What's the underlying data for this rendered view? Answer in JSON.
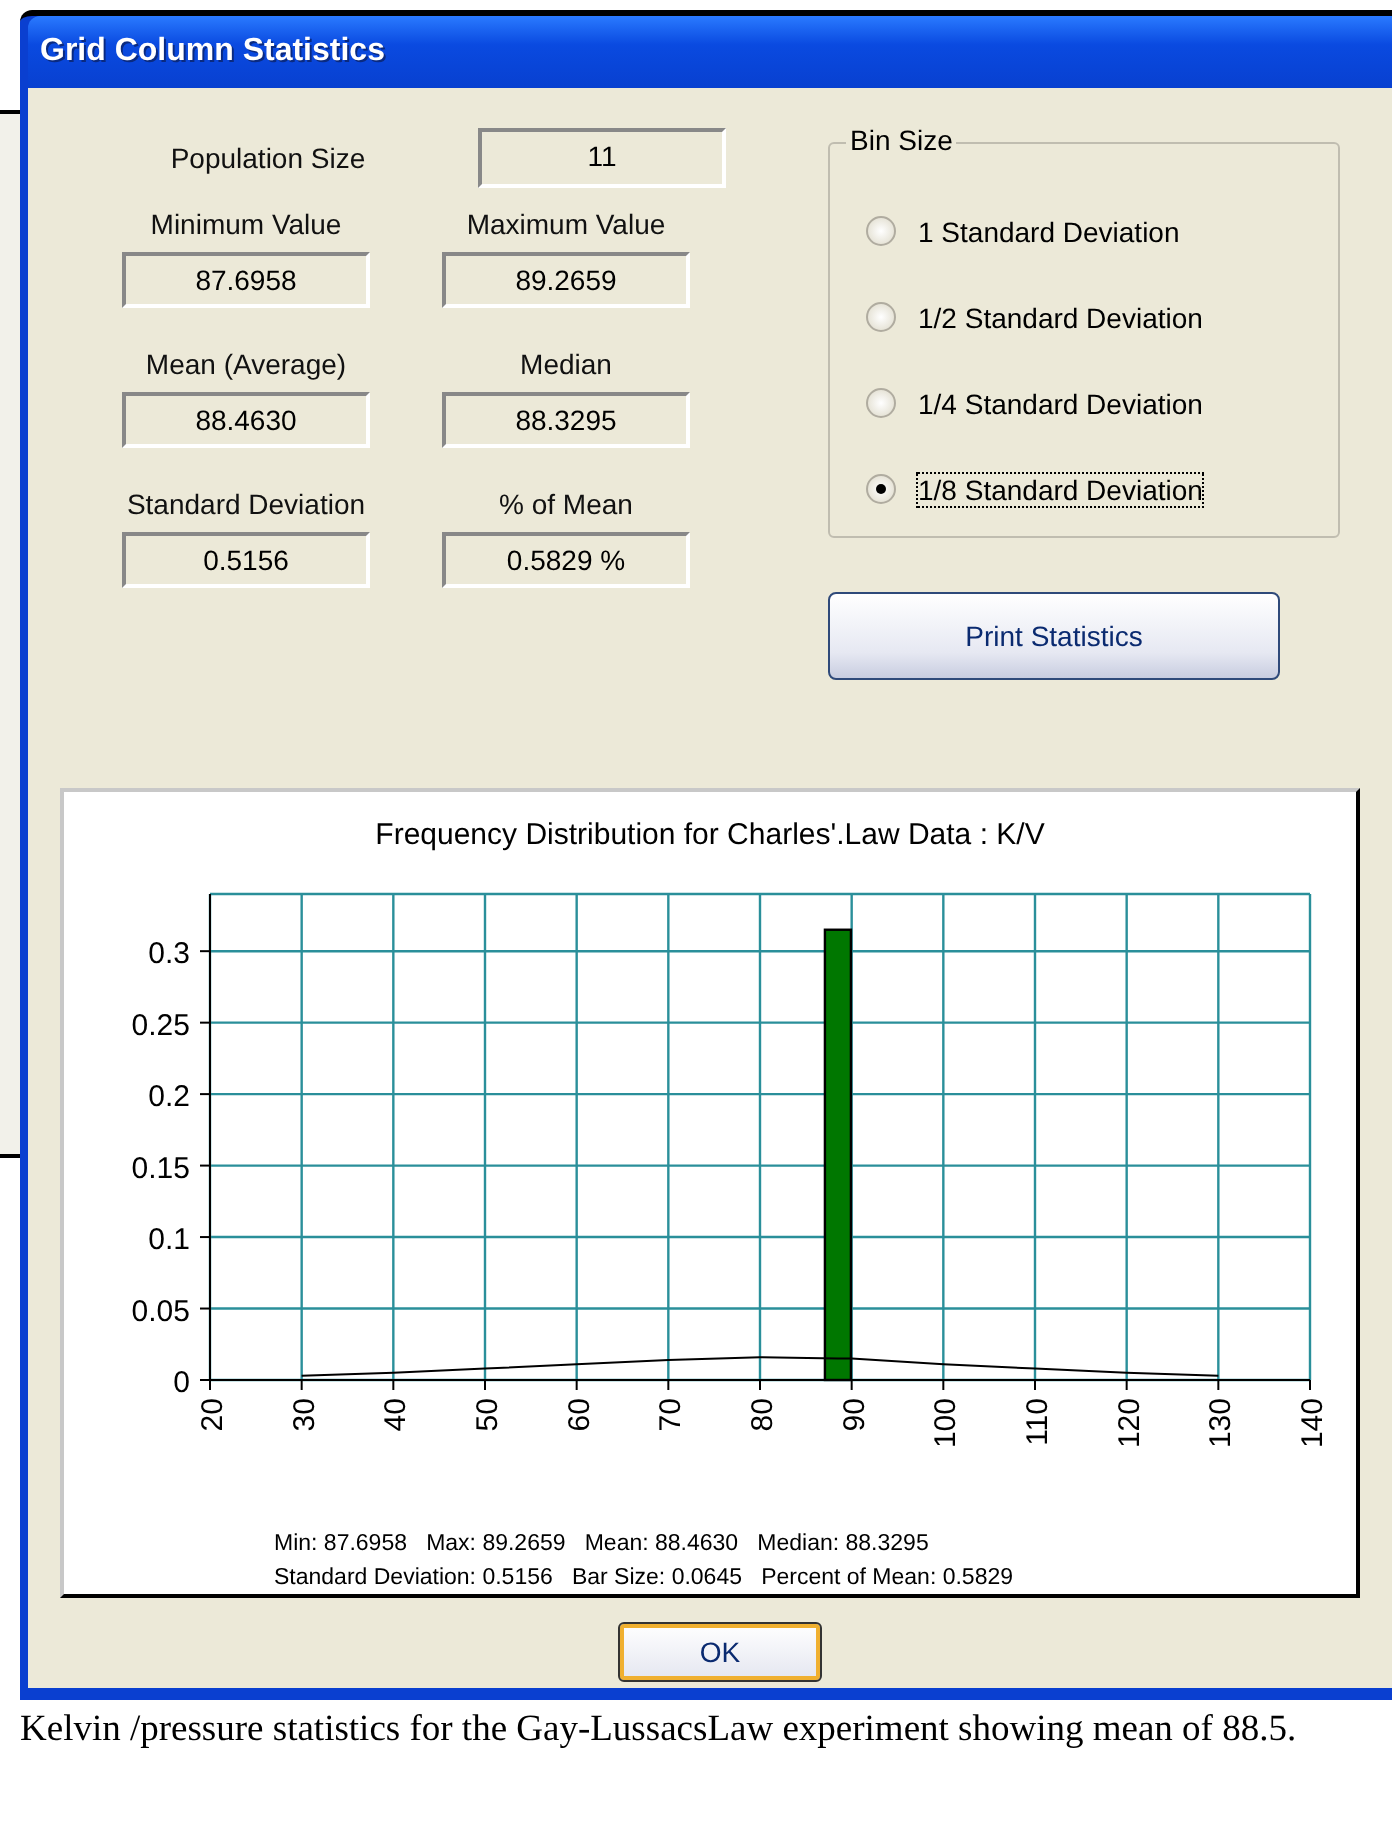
{
  "window": {
    "title": "Grid Column Statistics"
  },
  "fields": [
    {
      "label": "Population Size",
      "value": "11"
    },
    {
      "label": "Minimum Value",
      "value": "87.6958"
    },
    {
      "label": "Maximum Value",
      "value": "89.2659"
    },
    {
      "label": "Mean (Average)",
      "value": "88.4630"
    },
    {
      "label": "Median",
      "value": "88.3295"
    },
    {
      "label": "Standard Deviation",
      "value": "0.5156"
    },
    {
      "label": "% of Mean",
      "value": "0.5829 %"
    }
  ],
  "bin_size": {
    "title": "Bin Size",
    "options": [
      {
        "label": "1 Standard Deviation",
        "selected": false
      },
      {
        "label": "1/2 Standard Deviation",
        "selected": false
      },
      {
        "label": "1/4 Standard Deviation",
        "selected": false
      },
      {
        "label": "1/8 Standard Deviation",
        "selected": true
      }
    ]
  },
  "print_button": "Print Statistics",
  "chart": {
    "chart_data": {
      "type": "bar",
      "title": "Frequency Distribution for Charles'.Law Data : K/V",
      "x": [
        30,
        40,
        50,
        60,
        70,
        80,
        88.5,
        90,
        100,
        110,
        120,
        130
      ],
      "series": [
        {
          "type": "bar",
          "color": "#007700",
          "values": [
            null,
            null,
            null,
            null,
            null,
            null,
            0.315,
            null,
            null,
            null,
            null,
            null
          ]
        },
        {
          "type": "line",
          "color": "#000000",
          "values": [
            0.003,
            0.005,
            0.008,
            0.011,
            0.014,
            0.016,
            0.015,
            0.015,
            0.011,
            0.008,
            0.005,
            0.003
          ]
        }
      ],
      "grid": true,
      "xlim": [
        20,
        140
      ],
      "ylim": [
        0,
        0.34
      ],
      "xticks": [
        20,
        30,
        40,
        50,
        60,
        70,
        80,
        90,
        100,
        110,
        120,
        130,
        140
      ],
      "yticks": [
        0,
        0.05,
        0.1,
        0.15,
        0.2,
        0.25,
        0.3
      ]
    },
    "summary": [
      "Min: 87.6958   Max: 89.2659   Mean: 88.4630   Median: 88.3295",
      "Standard Deviation: 0.5156   Bar Size: 0.0645   Percent of Mean: 0.5829"
    ]
  },
  "ok_button": "OK",
  "caption": "Kelvin /pressure statistics for the Gay-LussacsLaw experiment showing mean of 88.5."
}
